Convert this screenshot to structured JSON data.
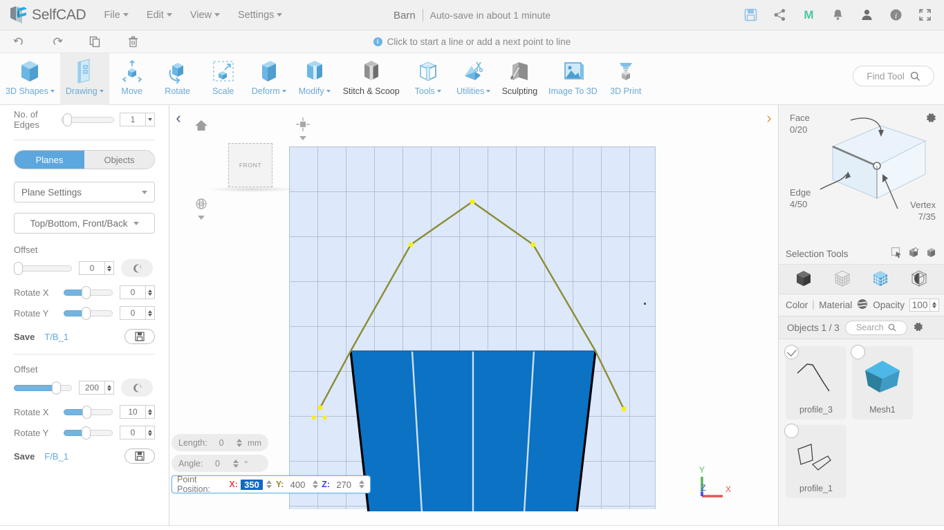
{
  "header": {
    "brand": "SelfCAD",
    "menus": [
      {
        "label": "File",
        "name": "menu-file"
      },
      {
        "label": "Edit",
        "name": "menu-edit"
      },
      {
        "label": "View",
        "name": "menu-view"
      },
      {
        "label": "Settings",
        "name": "menu-settings"
      }
    ],
    "project_name": "Barn",
    "autosave": "Auto-save in about 1 minute",
    "icons": [
      "save-icon",
      "share-icon",
      "m-logo-icon",
      "bell-icon",
      "user-icon",
      "info-icon",
      "fullscreen-icon"
    ]
  },
  "notification": {
    "text": "Click to start a line or add a next point to line",
    "icon": "info-icon",
    "undo": "undo-icon",
    "redo": "redo-icon",
    "copy": "copy-icon",
    "delete": "trash-icon"
  },
  "toolbar": {
    "items": [
      {
        "label": "3D Shapes",
        "dropdown": true,
        "active": false,
        "dark": false
      },
      {
        "label": "Drawing",
        "dropdown": true,
        "active": true,
        "dark": false
      },
      {
        "label": "Move",
        "dropdown": false,
        "active": false,
        "dark": false
      },
      {
        "label": "Rotate",
        "dropdown": false,
        "active": false,
        "dark": false
      },
      {
        "label": "Scale",
        "dropdown": false,
        "active": false,
        "dark": false
      },
      {
        "label": "Deform",
        "dropdown": true,
        "active": false,
        "dark": false
      },
      {
        "label": "Modify",
        "dropdown": true,
        "active": false,
        "dark": false
      },
      {
        "label": "Stitch & Scoop",
        "dropdown": false,
        "active": false,
        "dark": true
      },
      {
        "label": "Tools",
        "dropdown": true,
        "active": false,
        "dark": false
      },
      {
        "label": "Utilities",
        "dropdown": true,
        "active": false,
        "dark": false
      },
      {
        "label": "Sculpting",
        "dropdown": false,
        "active": false,
        "dark": true
      },
      {
        "label": "Image To 3D",
        "dropdown": false,
        "active": false,
        "dark": false
      },
      {
        "label": "3D Print",
        "dropdown": false,
        "active": false,
        "dark": false
      }
    ],
    "find_tool": "Find Tool"
  },
  "left_panel": {
    "no_of_edges_label": "No. of Edges",
    "no_of_edges_value": "1",
    "tab_planes": "Planes",
    "tab_objects": "Objects",
    "plane_settings": "Plane Settings",
    "plane_axis": "Top/Bottom, Front/Back",
    "group1": {
      "offset_label": "Offset",
      "offset_value": "0",
      "rotate_x_label": "Rotate X",
      "rotate_x_value": "0",
      "rotate_y_label": "Rotate Y",
      "rotate_y_value": "0",
      "save_label": "Save",
      "save_name": "T/B_1"
    },
    "group2": {
      "offset_label": "Offset",
      "offset_value": "200",
      "rotate_x_label": "Rotate X",
      "rotate_x_value": "10",
      "rotate_y_label": "Rotate Y",
      "rotate_y_value": "0",
      "save_label": "Save",
      "save_name": "F/B_1"
    }
  },
  "viewport": {
    "view_cube_label": "FRONT",
    "length_label": "Length:",
    "length_value": "0",
    "length_unit": "mm",
    "angle_label": "Angle:",
    "angle_value": "0",
    "angle_unit": "°",
    "point_position_label": "Point Position:",
    "x_label": "X:",
    "x_value": "350",
    "y_label": "Y:",
    "y_value": "400",
    "z_label": "Z:",
    "z_value": "270",
    "axis_x": "X",
    "axis_y": "Y",
    "axis_z": "Z",
    "colors": {
      "grid_bg": "#dde8fa",
      "grid_line": "#b5c1d4",
      "shape_fill": "#0b72c4",
      "profile_line": "#8c8c32",
      "point_marker": "#f8f000",
      "axis_x": "#e8554e",
      "axis_y": "#55b955",
      "axis_z": "#4a4af0"
    }
  },
  "right_panel": {
    "face_label": "Face",
    "face_count": "0/20",
    "edge_label": "Edge",
    "edge_count": "4/50",
    "vertex_label": "Vertex",
    "vertex_count": "7/35",
    "selection_tools_label": "Selection Tools",
    "selection_tool_icons": [
      "rect-select-icon",
      "box-select-add-icon",
      "box-select-icon"
    ],
    "mode_icons": [
      "object-mode-icon",
      "wireframe-mode-icon",
      "face-mode-icon",
      "sphere-mode-icon"
    ],
    "color_label": "Color",
    "material_label": "Material",
    "opacity_label": "Opacity",
    "opacity_value": "100",
    "objects_label": "Objects 1 / 3",
    "search_placeholder": "Search",
    "objects": [
      {
        "name": "profile_3",
        "selected": true,
        "thumb": "polyline-thumb"
      },
      {
        "name": "Mesh1",
        "selected": false,
        "thumb": "cube-thumb"
      },
      {
        "name": "profile_1",
        "selected": false,
        "thumb": "quads-thumb"
      }
    ]
  }
}
